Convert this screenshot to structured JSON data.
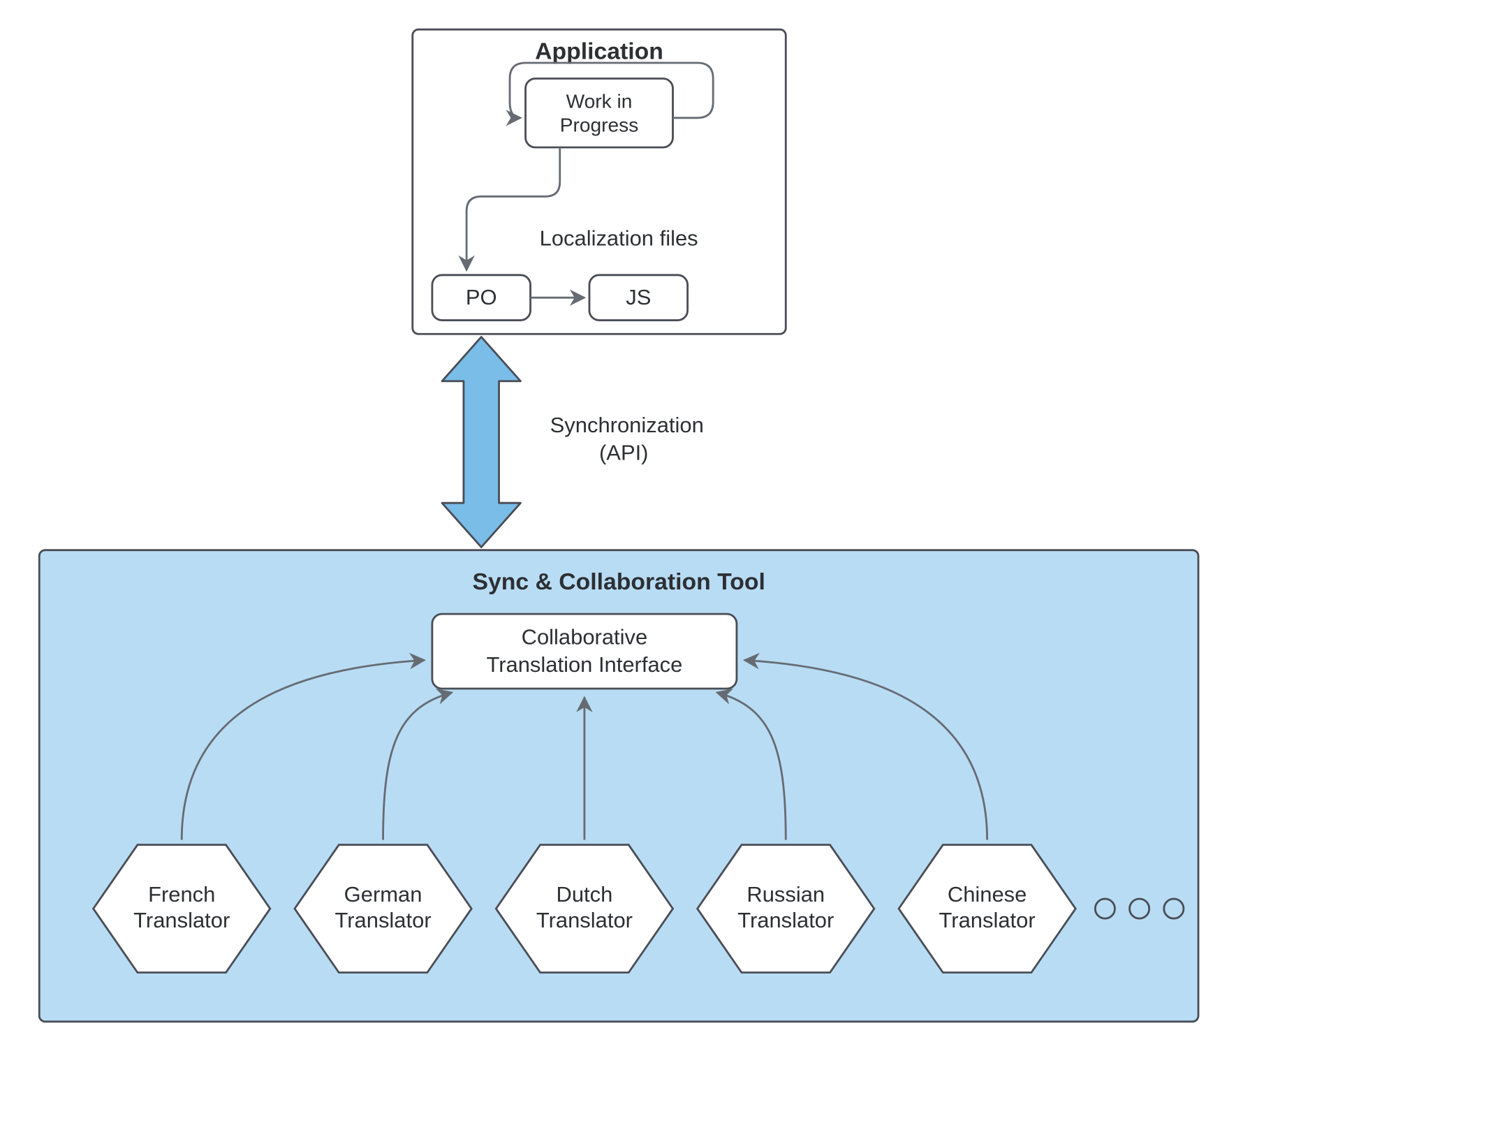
{
  "application": {
    "title": "Application",
    "wip1": "Work in",
    "wip2": "Progress",
    "loc_label": "Localization files",
    "po": "PO",
    "js": "JS"
  },
  "sync": {
    "line1": "Synchronization",
    "line2": "(API)"
  },
  "tool": {
    "title": "Sync & Collaboration Tool",
    "cti1": "Collaborative",
    "cti2": "Translation Interface"
  },
  "translators": {
    "t0a": "French",
    "t0b": "Translator",
    "t1a": "German",
    "t1b": "Translator",
    "t2a": "Dutch",
    "t2b": "Translator",
    "t3a": "Russian",
    "t3b": "Translator",
    "t4a": "Chinese",
    "t4b": "Translator"
  }
}
